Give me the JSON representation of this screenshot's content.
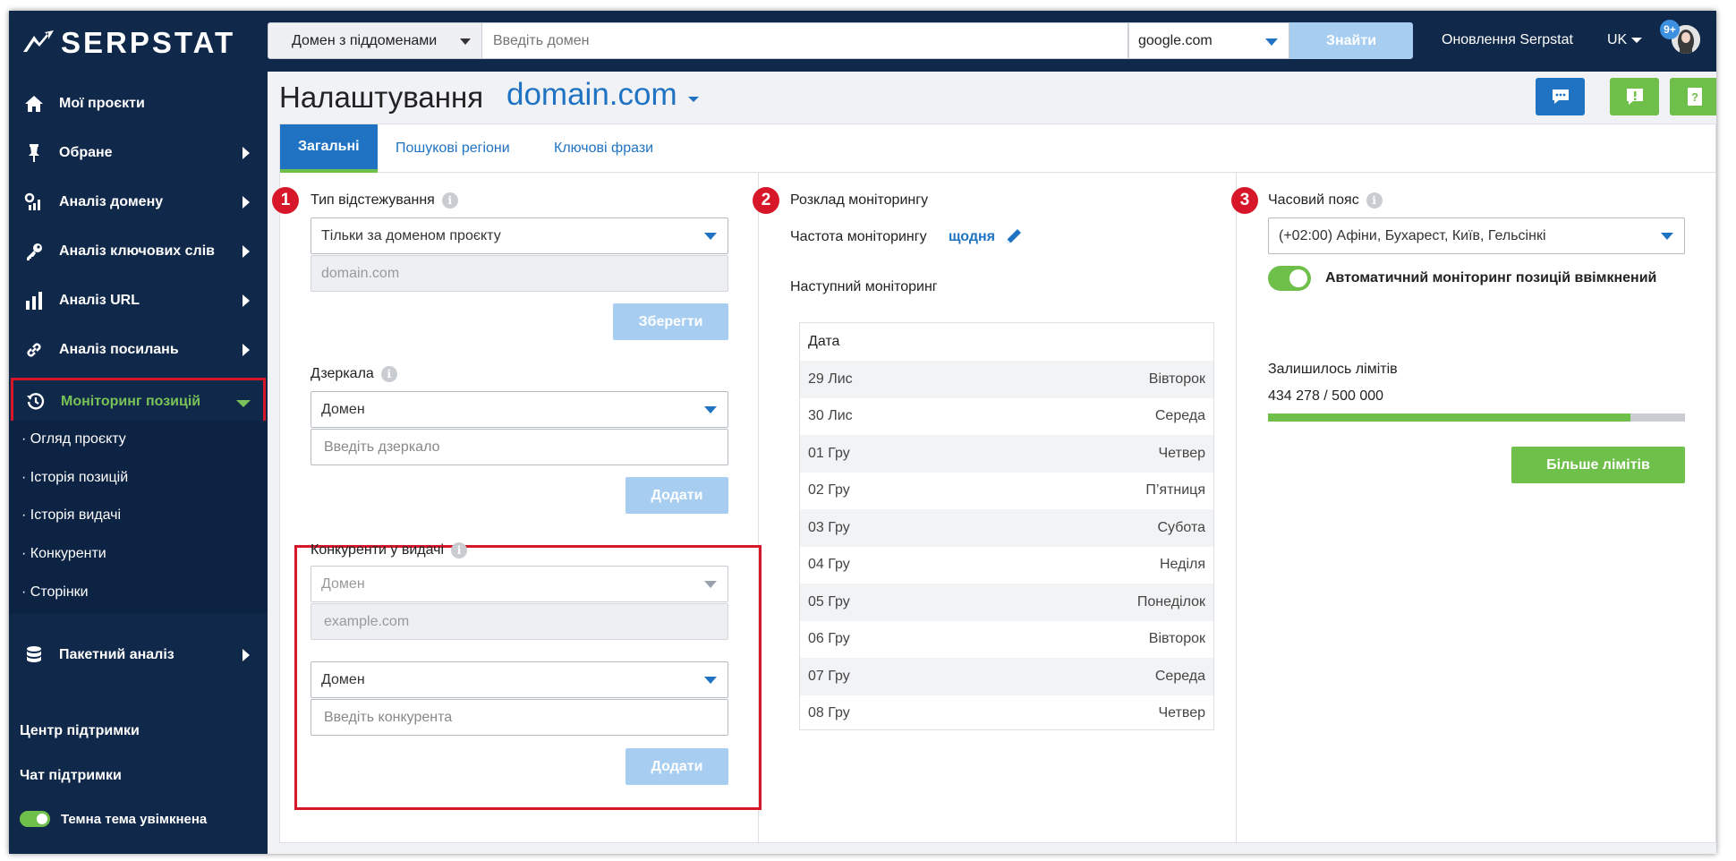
{
  "brand": {
    "name": "SERPSTAT"
  },
  "search": {
    "scope_label": "Домен з піддоменами",
    "placeholder": "Введіть домен",
    "engine": "google.com",
    "find_label": "Знайти"
  },
  "header": {
    "updates_label": "Оновлення Serpstat",
    "lang": "UK",
    "notifications_badge": "9+"
  },
  "sidebar": {
    "items": [
      {
        "label": "Мої проєкти",
        "icon": "home-icon"
      },
      {
        "label": "Обране",
        "icon": "pin-icon"
      },
      {
        "label": "Аналіз домену",
        "icon": "domain-analysis-icon"
      },
      {
        "label": "Аналіз ключових слів",
        "icon": "key-icon"
      },
      {
        "label": "Аналіз URL",
        "icon": "bar-chart-icon"
      },
      {
        "label": "Аналіз посилань",
        "icon": "link-icon"
      },
      {
        "label": "Моніторинг позицій",
        "icon": "history-icon"
      }
    ],
    "subitems": [
      "Огляд проєкту",
      "Історія позицій",
      "Історія видачі",
      "Конкуренти",
      "Сторінки"
    ],
    "batch_label": "Пакетний аналіз",
    "support_center": "Центр підтримки",
    "support_chat": "Чат підтримки",
    "dark_theme_label": "Темна тема увімкнена"
  },
  "page": {
    "title": "Налаштування",
    "domain": "domain.com"
  },
  "tabs": [
    "Загальні",
    "Пошукові регіони",
    "Ключові фрази"
  ],
  "tracking": {
    "step": "1",
    "label": "Тип відстежування",
    "type_value": "Тільки за доменом проєкту",
    "domain_value": "domain.com",
    "save_label": "Зберегти"
  },
  "mirrors": {
    "label": "Дзеркала",
    "select_value": "Домен",
    "input_placeholder": "Введіть дзеркало",
    "add_label": "Додати"
  },
  "competitors": {
    "label": "Конкуренти у видачі",
    "select1_value": "Домен",
    "input1_placeholder": "example.com",
    "select2_value": "Домен",
    "input2_placeholder": "Введіть конкурента",
    "add_label": "Додати"
  },
  "schedule": {
    "step": "2",
    "title": "Розклад моніторингу",
    "frequency_label": "Частота моніторингу",
    "frequency_value": "щодня",
    "next_label": "Наступний моніторинг",
    "date_header": "Дата",
    "rows": [
      {
        "date": "29 Лис",
        "day": "Вівторок"
      },
      {
        "date": "30 Лис",
        "day": "Середа"
      },
      {
        "date": "01 Гру",
        "day": "Четвер"
      },
      {
        "date": "02 Гру",
        "day": "П’ятниця"
      },
      {
        "date": "03 Гру",
        "day": "Субота"
      },
      {
        "date": "04 Гру",
        "day": "Неділя"
      },
      {
        "date": "05 Гру",
        "day": "Понеділок"
      },
      {
        "date": "06 Гру",
        "day": "Вівторок"
      },
      {
        "date": "07 Гру",
        "day": "Середа"
      },
      {
        "date": "08 Гру",
        "day": "Четвер"
      }
    ]
  },
  "timezone": {
    "step": "3",
    "label": "Часовий пояс",
    "value": "(+02:00) Афіни, Бухарест, Київ, Гельсінкі",
    "auto_label": "Автоматичний моніторинг позицій ввімкнений",
    "limits_label": "Залишилось лімітів",
    "limits_value": "434 278 / 500 000",
    "limits_fraction": 0.8686,
    "more_label": "Більше лімітів"
  },
  "colors": {
    "navy": "#10284a",
    "accent_blue": "#1f73c2",
    "green": "#6fbf4b",
    "highlight_red": "#d8162a"
  }
}
